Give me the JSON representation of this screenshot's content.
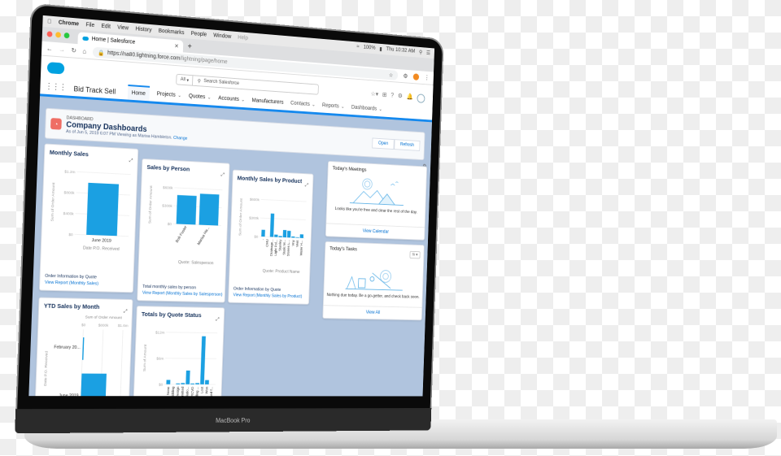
{
  "mac_menubar": {
    "apple_icon": "apple-icon",
    "items": [
      "Chrome",
      "File",
      "Edit",
      "View",
      "History",
      "Bookmarks",
      "People",
      "Window",
      "Help"
    ],
    "battery": "100%",
    "clock": "Thu 10:32 AM"
  },
  "browser": {
    "tab_title": "Home | Salesforce",
    "url_host": "https://na80.lightning.force.com",
    "url_path": "/lightning/page/home"
  },
  "salesforce": {
    "search_scope": "All",
    "search_placeholder": "Search Salesforce",
    "app_name": "Bid Track Sell",
    "nav_items": [
      {
        "label": "Home",
        "active": true,
        "has_menu": false
      },
      {
        "label": "Projects",
        "has_menu": true
      },
      {
        "label": "Quotes",
        "has_menu": true
      },
      {
        "label": "Accounts",
        "has_menu": true
      },
      {
        "label": "Manufacturers",
        "has_menu": false
      },
      {
        "label": "Contacts",
        "has_menu": true
      },
      {
        "label": "Reports",
        "has_menu": true
      },
      {
        "label": "Dashboards",
        "has_menu": true
      }
    ]
  },
  "dashboard": {
    "kicker": "DASHBOARD",
    "title": "Company Dashboards",
    "subtitle": "As of Jun 5, 2019 6:07 PM Viewing as Marisa Hambleton.",
    "change_link": "Change",
    "open_label": "Open",
    "refresh_label": "Refresh"
  },
  "cards": {
    "monthly_sales": {
      "title": "Monthly Sales",
      "footer": "Order Information by Quote",
      "link": "View Report (Monthly Sales)"
    },
    "sales_by_person": {
      "title": "Sales by Person",
      "footer": "Total monthly sales by person",
      "link": "View Report (Monthly Sales by Salesperson)"
    },
    "monthly_by_product": {
      "title": "Monthly Sales by Product",
      "footer": "Order Information by Quote",
      "link": "View Report (Monthly Sales by Product)"
    },
    "ytd_by_month": {
      "title": "YTD Sales by Month"
    },
    "totals_by_status": {
      "title": "Totals by Quote Status"
    }
  },
  "meetings": {
    "title": "Today's Meetings",
    "message": "Looks like you're free and clear the rest of the day.",
    "link": "View Calendar"
  },
  "tasks": {
    "title": "Today's Tasks",
    "message": "Nothing due today. Be a go-getter, and check back soon.",
    "link": "View All"
  },
  "device_label": "MacBook Pro",
  "colors": {
    "bar": "#1ba0e2",
    "link": "#0070d2",
    "brand": "#00a1e0",
    "accent": "#1589ee"
  },
  "chart_data": [
    {
      "type": "bar",
      "title": "Monthly Sales",
      "categories": [
        "June 2019"
      ],
      "values": [
        1000000
      ],
      "xlabel": "Date P.O. Received",
      "ylabel": "Sum of Order Amount",
      "yticks": [
        "$0",
        "$400k",
        "$800k",
        "$1.2m"
      ],
      "ylim": [
        0,
        1200000
      ]
    },
    {
      "type": "bar",
      "title": "Sales by Person",
      "categories": [
        "Bob Foster",
        "Marisa Ha..."
      ],
      "values": [
        480000,
        520000
      ],
      "xlabel": "Quote: Salesperson",
      "ylabel": "Sum of Order Amount",
      "yticks": [
        "$0",
        "$300k",
        "$600k"
      ],
      "ylim": [
        0,
        600000
      ]
    },
    {
      "type": "bar",
      "title": "Monthly Sales by Product",
      "categories": [
        "-",
        "CMU",
        "Drainage...",
        "Light Pol...",
        "Stanley",
        "Static M...",
        "Stones L...",
        "Vny",
        "Vent",
        "Water H..."
      ],
      "values": [
        110000,
        0,
        380000,
        40000,
        20000,
        120000,
        110000,
        20000,
        10000,
        60000
      ],
      "xlabel": "Quote: Product Name",
      "ylabel": "Sum of Order Amount",
      "yticks": [
        "$0",
        "$300k",
        "$600k"
      ],
      "ylim": [
        0,
        600000
      ]
    },
    {
      "type": "bar",
      "title": "YTD Sales by Month",
      "orientation": "horizontal",
      "categories": [
        "February 20...",
        "June 2019"
      ],
      "values": [
        40000,
        1000000
      ],
      "xlabel": "Sum of Order Amount",
      "ylabel": "Date P.O. Received",
      "xticks": [
        "$0",
        "$800k",
        "$1.6m"
      ],
      "xlim": [
        0,
        1600000
      ]
    },
    {
      "type": "bar",
      "title": "Totals by Quote Status",
      "categories": [
        "None",
        "Bidding",
        "Design",
        "Submitted",
        "Negotiatio...",
        "PO RCVD",
        "Pending ...",
        "Lost",
        "Won",
        "Closed f..."
      ],
      "values": [
        1000000,
        0,
        200000,
        300000,
        3200000,
        200000,
        300000,
        11200000,
        1000000,
        0
      ],
      "xlabel": "",
      "ylabel": "Sum of Amount",
      "yticks": [
        "$0",
        "$6m",
        "$12m"
      ],
      "ylim": [
        0,
        12000000
      ]
    }
  ]
}
